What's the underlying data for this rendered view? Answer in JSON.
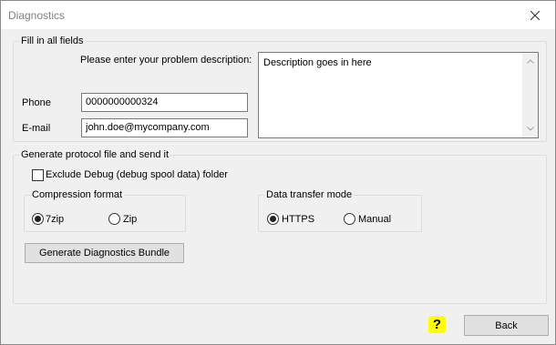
{
  "window": {
    "title": "Diagnostics"
  },
  "fill_group": {
    "legend": "Fill in all fields",
    "description_label": "Please enter your problem description:",
    "description_value": "Description goes in here",
    "phone_label": "Phone",
    "phone_value": "0000000000324",
    "email_label": "E-mail",
    "email_value": "john.doe@mycompany.com"
  },
  "protocol_group": {
    "legend": "Generate protocol file and send it",
    "exclude_label": "Exclude Debug (debug spool data) folder",
    "exclude_checked": false,
    "compression": {
      "legend": "Compression format",
      "options": [
        "7zip",
        "Zip"
      ],
      "selected": "7zip"
    },
    "transfer": {
      "legend": "Data transfer mode",
      "options": [
        "HTTPS",
        "Manual"
      ],
      "selected": "HTTPS"
    },
    "generate_button": "Generate Diagnostics Bundle"
  },
  "footer": {
    "help_glyph": "?",
    "back_button": "Back"
  },
  "icons": {
    "close": "close-icon",
    "scroll_up": "chevron-up-icon",
    "scroll_down": "chevron-down-icon",
    "help": "help-icon"
  },
  "colors": {
    "help_background": "#ffff00"
  }
}
